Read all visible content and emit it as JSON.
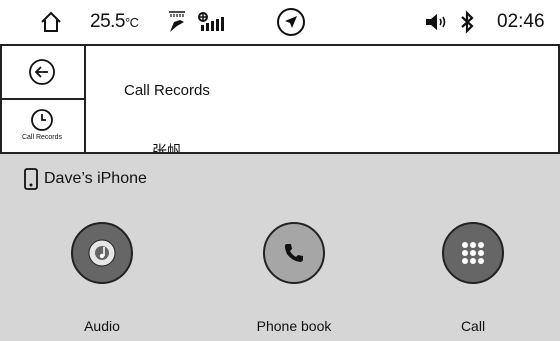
{
  "status_bar": {
    "home_icon": "home-icon",
    "temperature": "25.5",
    "temperature_unit": "°C",
    "climate_icon": "fan-seat-icon",
    "fan_icon": "fan-speed-icon",
    "navigation_icon": "navigation-arrow-icon",
    "volume_icon": "speaker-volume-icon",
    "bluetooth_icon": "bluetooth-icon",
    "time": "02:46"
  },
  "left_nav": {
    "back_icon": "back-arrow-icon",
    "records_icon": "clock-icon",
    "records_label": "Call Records"
  },
  "content": {
    "title": "Call Records",
    "entry": "张帆"
  },
  "device_panel": {
    "device_icon": "phone-icon",
    "device_name": "Dave’s iPhone",
    "actions": [
      {
        "label": "Audio",
        "icon": "music-disc-icon",
        "style": "dark"
      },
      {
        "label": "Phone book",
        "icon": "phone-handset-icon",
        "style": "light"
      },
      {
        "label": "Call",
        "icon": "keypad-icon",
        "style": "dark"
      }
    ]
  },
  "colors": {
    "panel_background": "#d6d6d6",
    "button_dark": "#666666",
    "button_light": "#a6a6a6",
    "border": "#222222"
  }
}
